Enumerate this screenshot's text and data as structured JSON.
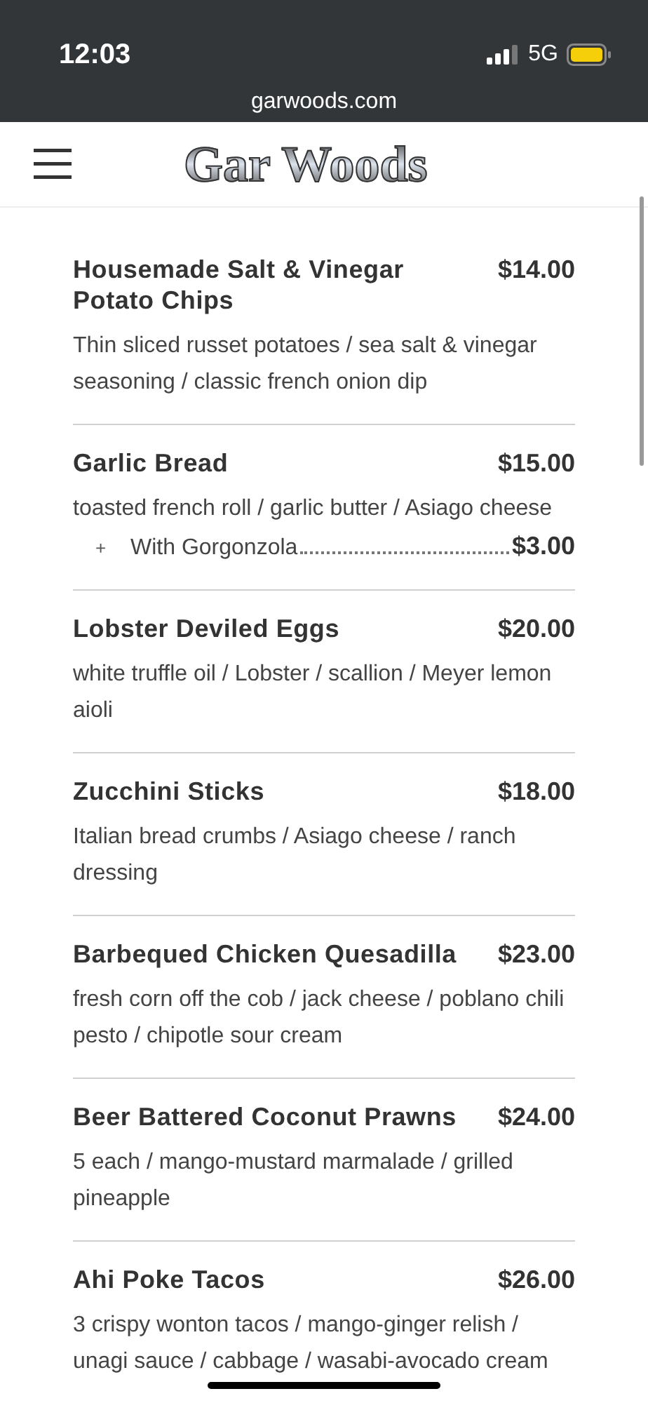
{
  "status_bar": {
    "time": "12:03",
    "network": "5G"
  },
  "browser": {
    "url": "garwoods.com"
  },
  "header": {
    "logo": "Gar Woods"
  },
  "menu_items": [
    {
      "name": "Housemade Salt & Vinegar Potato Chips",
      "price": "$14.00",
      "description": "Thin sliced russet potatoes / sea salt & vinegar seasoning / classic french onion dip"
    },
    {
      "name": "Garlic Bread",
      "price": "$15.00",
      "description": "toasted french roll / garlic butter / Asiago cheese",
      "addons": [
        {
          "marker": "+",
          "name": "With Gorgonzola",
          "price": "$3.00"
        }
      ]
    },
    {
      "name": "Lobster Deviled Eggs",
      "price": "$20.00",
      "description": "white truffle oil / Lobster / scallion / Meyer lemon aioli"
    },
    {
      "name": "Zucchini Sticks",
      "price": "$18.00",
      "description": "Italian bread crumbs / Asiago cheese / ranch dressing"
    },
    {
      "name": "Barbequed Chicken Quesadilla",
      "price": "$23.00",
      "description": "fresh corn off the cob / jack cheese / poblano chili pesto / chipotle sour cream"
    },
    {
      "name": "Beer Battered Coconut Prawns",
      "price": "$24.00",
      "description": "5 each / mango-mustard marmalade / grilled pineapple"
    },
    {
      "name": "Ahi Poke Tacos",
      "price": "$26.00",
      "description": "3 crispy wonton tacos / mango-ginger relish / unagi sauce / cabbage / wasabi-avocado cream"
    }
  ]
}
